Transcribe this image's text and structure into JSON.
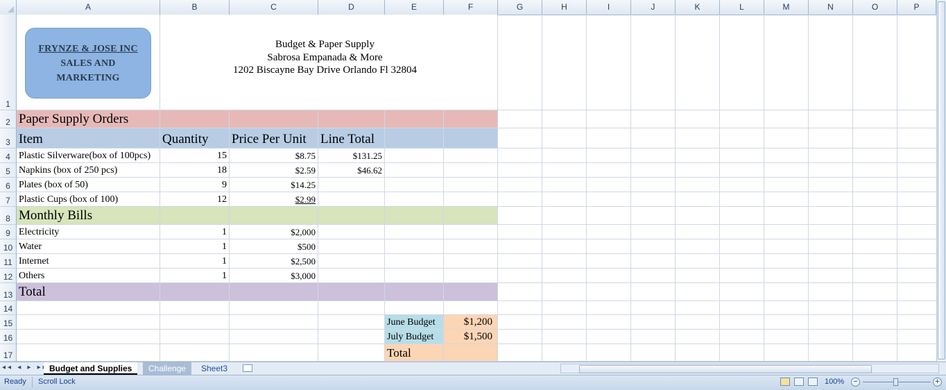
{
  "columns": [
    "A",
    "B",
    "C",
    "D",
    "E",
    "F",
    "G",
    "H",
    "I",
    "J",
    "K",
    "L",
    "M",
    "N",
    "O",
    "P"
  ],
  "rows": [
    "1",
    "2",
    "3",
    "4",
    "5",
    "6",
    "7",
    "8",
    "9",
    "10",
    "11",
    "12",
    "13",
    "14",
    "15",
    "16",
    "17"
  ],
  "logo": {
    "line1": "FRYNZE & JOSE INC",
    "line2": "SALES AND",
    "line3": "MARKETING"
  },
  "address": {
    "line1": "Budget & Paper Supply",
    "line2": "Sabrosa Empanada & More",
    "line3": "1202 Biscayne Bay Drive Orlando Fl 32804"
  },
  "section_paper": "Paper Supply Orders",
  "headers": {
    "item": "Item",
    "quantity": "Quantity",
    "price": "Price Per Unit",
    "line_total": "Line Total"
  },
  "items": [
    {
      "item": "Plastic Silverware(box of 100pcs)",
      "qty": "15",
      "price": "$8.75",
      "total": "$131.25"
    },
    {
      "item": "Napkins (box of 250 pcs)",
      "qty": "18",
      "price": "$2.59",
      "total": "$46.62"
    },
    {
      "item": "Plates (box of 50)",
      "qty": "9",
      "price": "$14.25",
      "total": ""
    },
    {
      "item": "Plastic Cups (box of 100)",
      "qty": "12",
      "price": "$2.99",
      "total": ""
    }
  ],
  "section_bills": "Monthly Bills",
  "bills": [
    {
      "item": "Electricity",
      "qty": "1",
      "price": "$2,000"
    },
    {
      "item": "Water",
      "qty": "1",
      "price": "$500"
    },
    {
      "item": "Internet",
      "qty": "1",
      "price": "$2,500"
    },
    {
      "item": "Others",
      "qty": "1",
      "price": "$3,000"
    }
  ],
  "section_total": "Total",
  "budget": {
    "june_label": "June Budget",
    "june_value": "$1,200",
    "july_label": "July Budget",
    "july_value": "$1,500",
    "total_label": "Total"
  },
  "sheets": {
    "active": "Budget and Supplies",
    "tab2": "Challenge",
    "tab3": "Sheet3"
  },
  "status": {
    "ready": "Ready",
    "scroll_lock": "Scroll Lock",
    "zoom": "100%"
  },
  "colors": {
    "paper_band": "#e6b9b8",
    "header_band": "#b8cce4",
    "bills_band": "#d7e4bc",
    "total_band": "#ccc0da",
    "logo": "#8db4e2",
    "budget_label": "#b7dee8",
    "budget_value": "#fcd5b4"
  }
}
